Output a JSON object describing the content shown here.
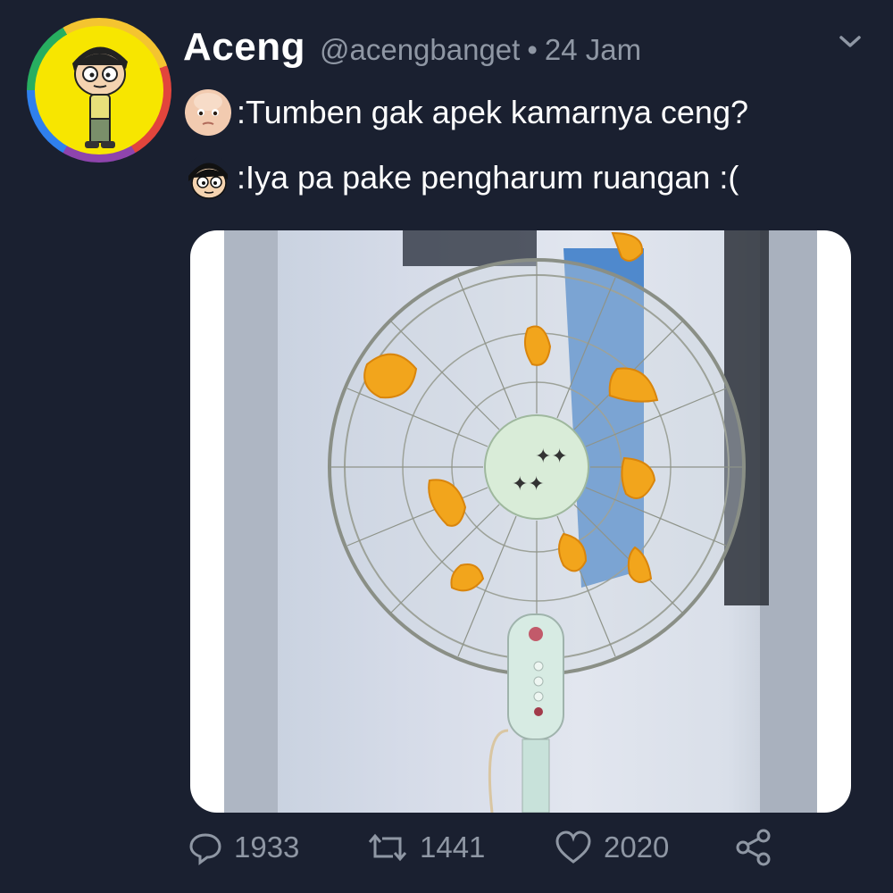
{
  "tweet": {
    "display_name": "Aceng",
    "handle": "@acengbanget",
    "separator": "•",
    "time": "24 Jam",
    "lines": [
      {
        "emoji": "baby-face-emoji",
        "text": ":Tumben gak apek kamarnya ceng?"
      },
      {
        "emoji": "aceng-face-emoji",
        "text": ":Iya pa pake pengharum ruangan :("
      }
    ],
    "media": {
      "subject": "electric fan with orange peels"
    }
  },
  "actions": {
    "replies": "1933",
    "retweets": "1441",
    "likes": "2020"
  },
  "colors": {
    "background": "#1a2030",
    "muted_text": "#8f97a4",
    "text": "#ffffff"
  }
}
